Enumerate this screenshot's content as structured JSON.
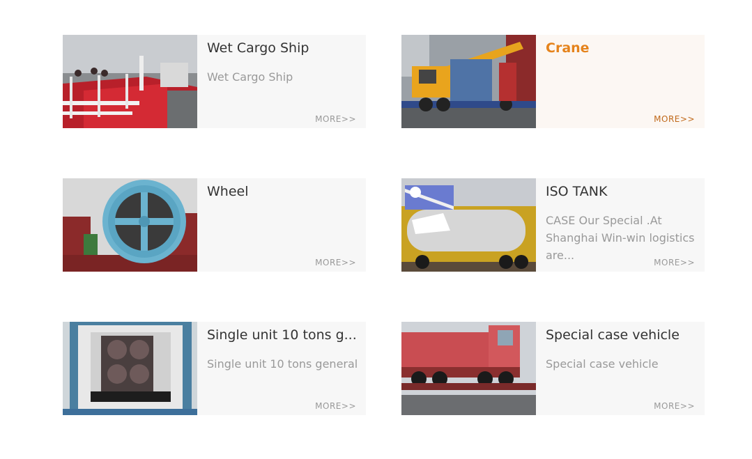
{
  "items": [
    {
      "title": "Wet Cargo Ship",
      "desc": "Wet Cargo Ship",
      "more": "MORE>>",
      "image": "ship-deck-photo"
    },
    {
      "title": "Crane",
      "desc": "",
      "more": "MORE>>",
      "image": "crane-truck-photo",
      "active": true
    },
    {
      "title": "Wheel",
      "desc": "",
      "more": "MORE>>",
      "image": "cable-reel-photo"
    },
    {
      "title": "ISO TANK",
      "desc": "CASE Our Special .At Shanghai Win-win logistics are...",
      "more": "MORE>>",
      "image": "iso-tank-photo"
    },
    {
      "title": "Single unit 10 tons g...",
      "desc": "Single unit 10 tons general",
      "more": "MORE>>",
      "image": "container-cargo-photo"
    },
    {
      "title": "Special case vehicle",
      "desc": "Special case vehicle",
      "more": "MORE>>",
      "image": "dump-truck-photo"
    }
  ],
  "colors": {
    "accent": "#e5831c",
    "card_bg": "#f7f7f7",
    "text": "#333333",
    "muted": "#999999"
  }
}
